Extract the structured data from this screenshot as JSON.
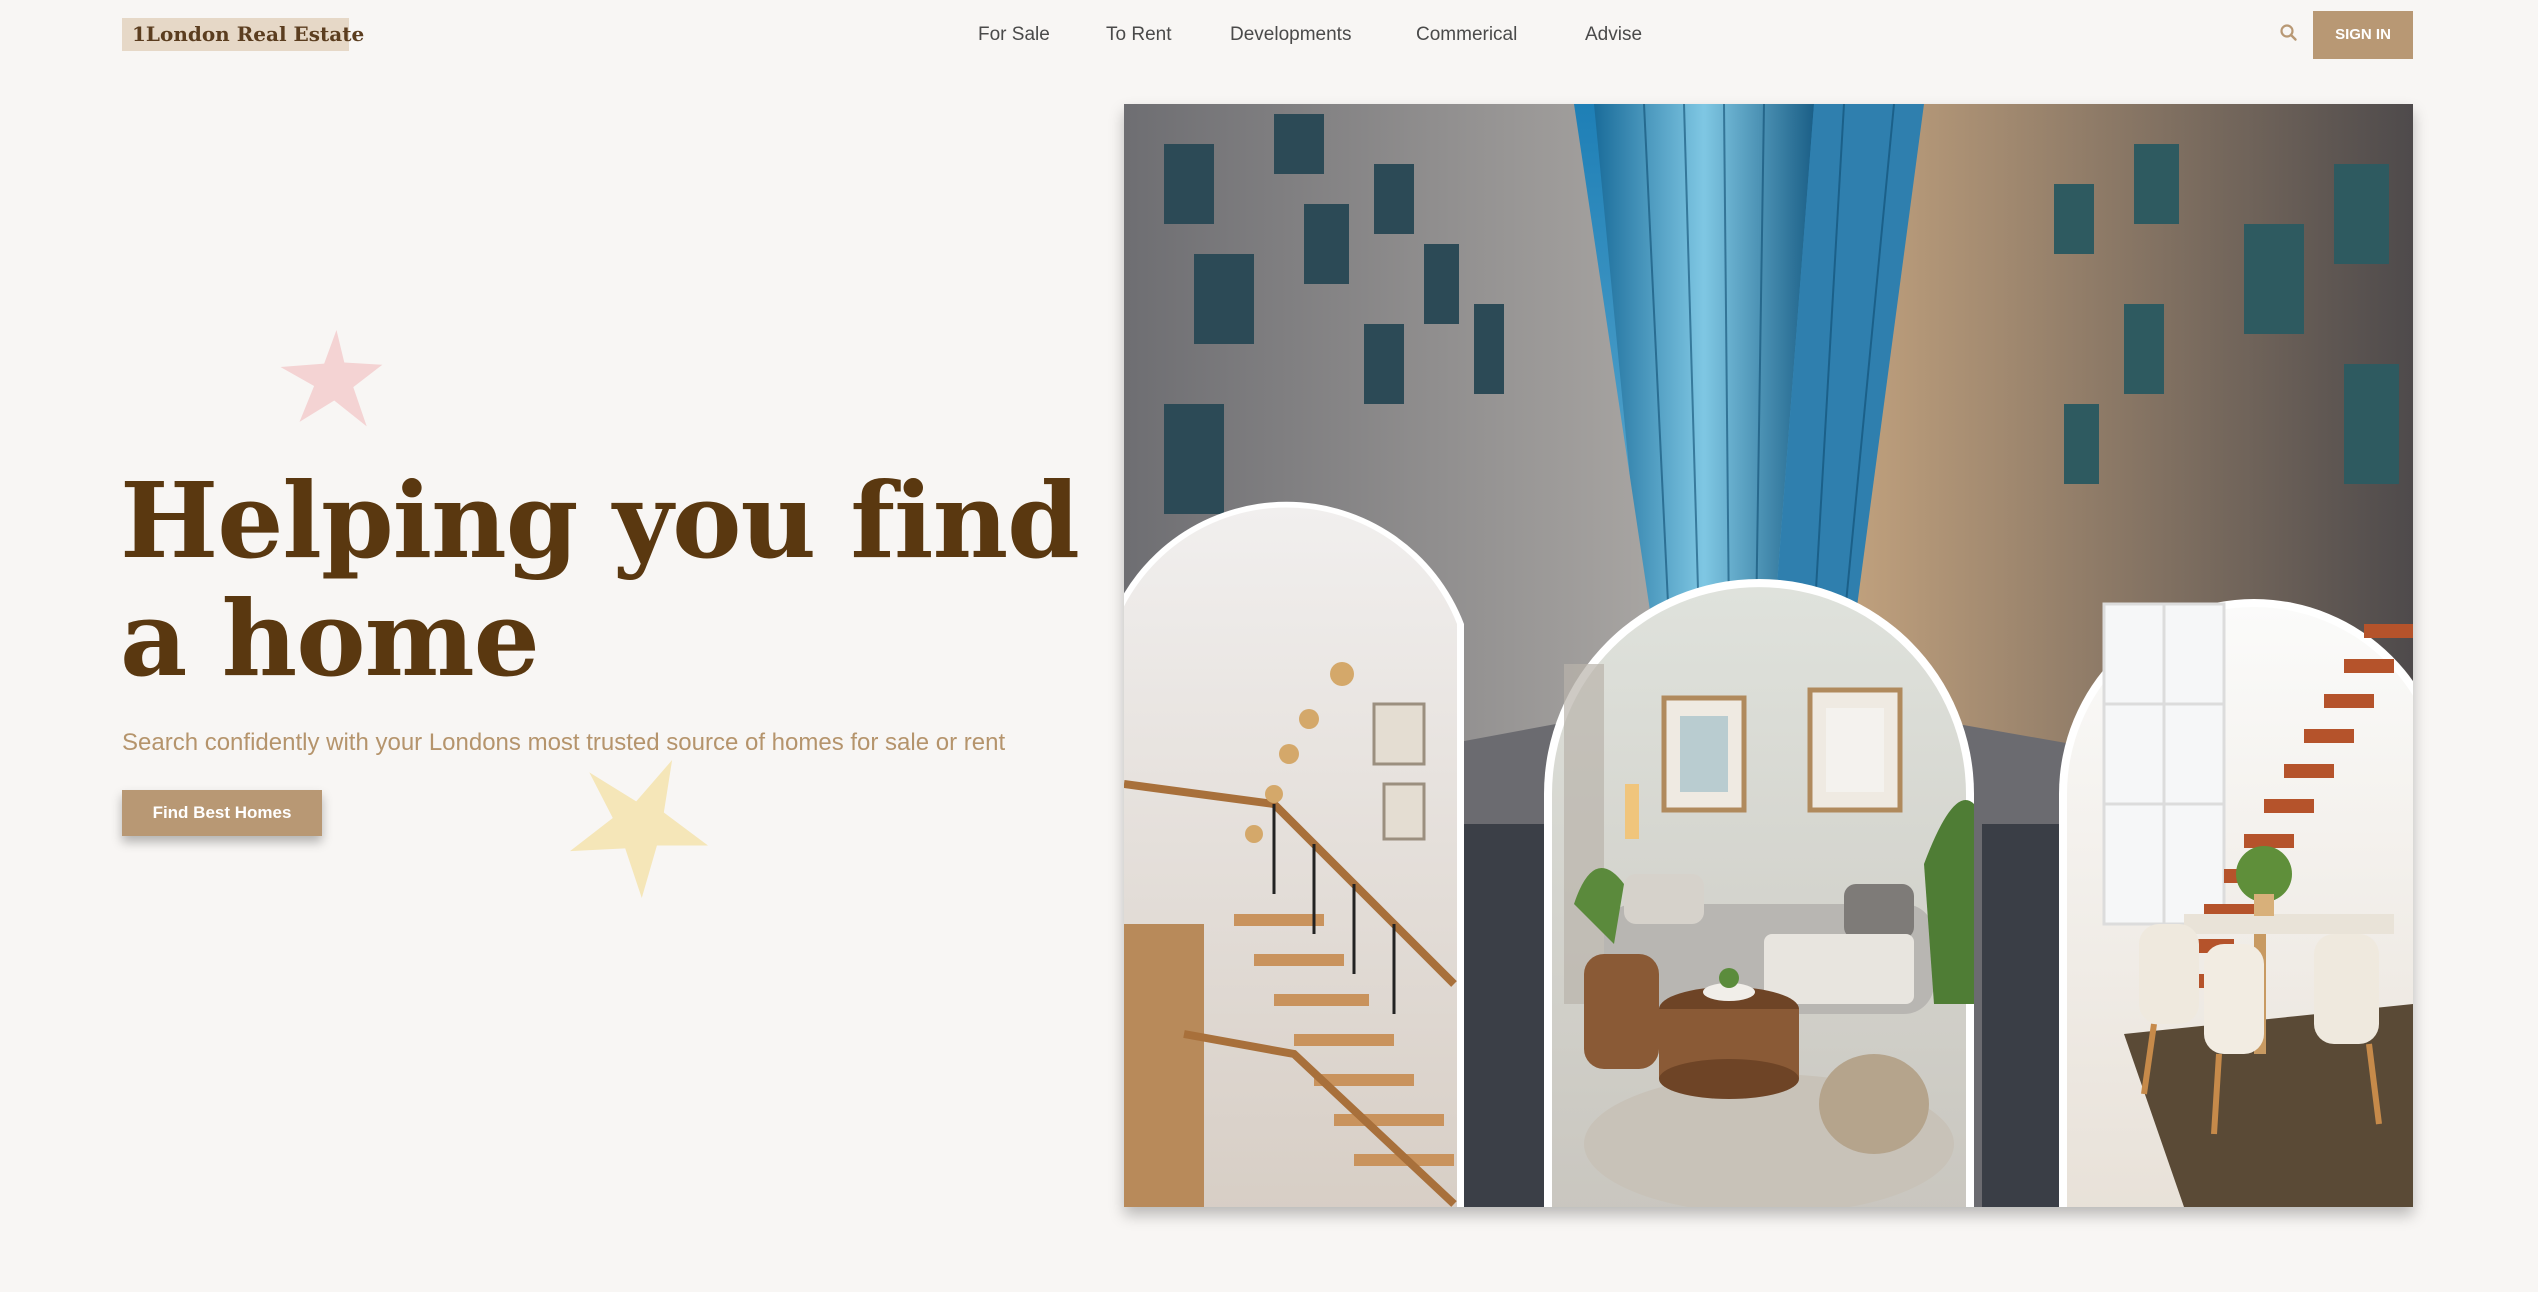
{
  "header": {
    "logo": "1London Real Estate",
    "nav": [
      {
        "label": "For Sale"
      },
      {
        "label": "To Rent"
      },
      {
        "label": "Developments"
      },
      {
        "label": "Commerical"
      },
      {
        "label": "Advise"
      }
    ],
    "search_icon": "search-icon",
    "signin_label": "SIGN IN"
  },
  "hero": {
    "title": "Helping you find a home",
    "subtitle": "Search confidently with your Londons most trusted source of homes for sale or rent",
    "cta_label": "Find Best Homes"
  },
  "colors": {
    "background": "#f8f6f4",
    "brand": "#b89874",
    "title": "#5a3810",
    "subtitle": "#b5946c",
    "logo_bg": "#e6d8c7",
    "star_pink": "#f4d3d3",
    "star_yellow": "#f5e6b8"
  }
}
